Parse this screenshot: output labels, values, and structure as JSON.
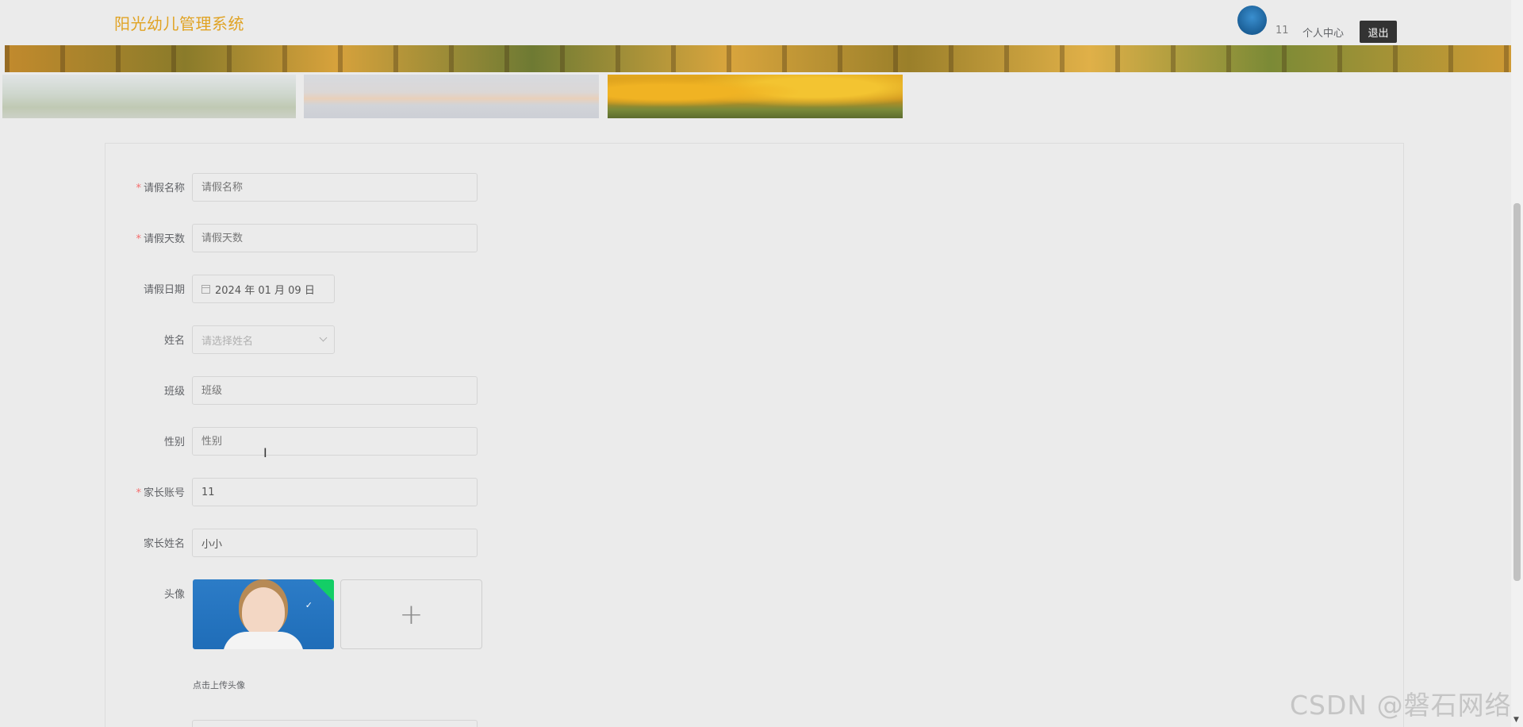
{
  "header": {
    "brand": "阳光幼儿管理系统",
    "user_name": "11",
    "profile_label": "个人中心",
    "logout_label": "退出"
  },
  "form": {
    "fields": [
      {
        "label": "请假名称",
        "required": true,
        "value": "",
        "placeholder": "请假名称"
      },
      {
        "label": "请假天数",
        "required": true,
        "value": "",
        "placeholder": "请假天数"
      },
      {
        "label": "请假日期",
        "required": false,
        "value": "2024 年 01 月 09 日",
        "placeholder": ""
      },
      {
        "label": "姓名",
        "required": false,
        "value": "",
        "placeholder": "请选择姓名"
      },
      {
        "label": "班级",
        "required": false,
        "value": "",
        "placeholder": "班级"
      },
      {
        "label": "性别",
        "required": false,
        "value": "",
        "placeholder": "性别"
      },
      {
        "label": "家长账号",
        "required": true,
        "value": "11",
        "placeholder": ""
      },
      {
        "label": "家长姓名",
        "required": false,
        "value": "小小",
        "placeholder": ""
      }
    ],
    "avatar": {
      "label": "头像",
      "add_symbol": "+",
      "tip": "点击上传头像",
      "check": "✓"
    }
  },
  "watermark": "CSDN @磐石网络",
  "icons": {
    "calendar": "calendar-icon",
    "chevron": "chevron-down-icon",
    "text_cursor": "text-cursor-icon"
  },
  "colors": {
    "brand": "#e0a324",
    "required": "#f56c6c",
    "success_corner": "#13ce66",
    "logout_bg": "#333333"
  }
}
